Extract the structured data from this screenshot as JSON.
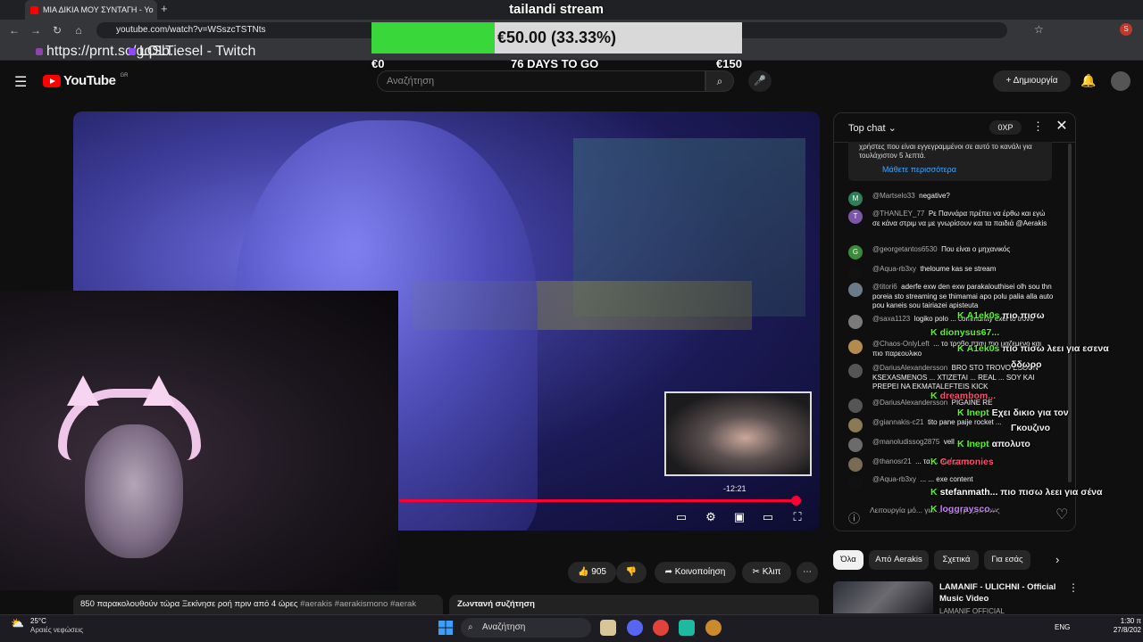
{
  "browser": {
    "tab_title": "ΜΙΑ ΔΙΚΙΑ ΜΟΥ ΣΥΝΤΑΓΗ - Yo",
    "url": "youtube.com/watch?v=WSszcTSTNts",
    "bookmarks": [
      "https://prnt.sc/gqSb...",
      "LOLTiesel - Twitch"
    ]
  },
  "youtube": {
    "logo": "YouTube",
    "region": "GR",
    "search_placeholder": "Αναζήτηση",
    "create_label": "Δημιουργία"
  },
  "donation": {
    "title": "tailandi stream",
    "amount_text": "€50.00 (33.33%)",
    "progress_pct": 33.33,
    "min_label": "€0",
    "days_label": "76 DAYS TO GO",
    "max_label": "€150"
  },
  "player": {
    "time_remaining": "-12:21",
    "progress_pct": 96
  },
  "actions": {
    "likes": "905",
    "share": "Κοινοποίηση",
    "clip": "Κλιπ",
    "more": "⋯"
  },
  "description": {
    "text": "850 παρακολουθούν τώρα  Ξεκίνησε ροή πριν από 4 ώρες",
    "tags": "#aerakis #aerakismono #aerak",
    "live_chat": "Ζωντανή συζήτηση"
  },
  "chat": {
    "title": "Top chat",
    "xp": "0XP",
    "info_text": "χρήστες που είναι εγγεγραμμένοι σε αυτό το κανάλι για τουλάχιστον 5 λεπτά.",
    "info_link": "Μάθετε περισσότερα",
    "messages": [
      {
        "avatar": "M",
        "color": "#2e7d5b",
        "user": "@Martselo33",
        "text": "negative?"
      },
      {
        "avatar": "T",
        "color": "#7b57a8",
        "user": "@THANLEY_77",
        "text": "Ρε Παννάρα πρέπει να έρθω και εγώ σε κάνα στριμ να με γνωρίσουν και τα παιδιά @Aerakis"
      },
      {
        "avatar": "G",
        "color": "#3a8b3a",
        "user": "@georgetantos6530",
        "text": "Που είναι ο μηχανικός"
      },
      {
        "avatar": "",
        "color": "#111111",
        "user": "@Aqua-rb3xy",
        "text": "theloume kas se stream"
      },
      {
        "avatar": "",
        "color": "#6a7a86",
        "user": "@titori6",
        "text": "aderfe exw den exw parakalouthisei olh sou thn poreia sto streaming se thimamai apo polu palia alla auto pou kaneis sou tairiazei apisteuta"
      },
      {
        "avatar": "",
        "color": "#7a7a7a",
        "user": "@saxa1123",
        "text": "logiko polo ... community exei to trovo"
      },
      {
        "avatar": "",
        "color": "#b38b4d",
        "user": "@Chaos-OnlyLeft",
        "text": "... το τροβο πταν πιο μαζεμενο και πιο παρεουλικο"
      },
      {
        "avatar": "",
        "color": "#555555",
        "user": "@DariusAlexandersson",
        "text": "BRO STO TROVO ESOUN KSEXASMENOS ... XTIZETAI ... REAL ... SOY KAI PREPEI NA EKMATALEFTEIS KICK"
      },
      {
        "avatar": "",
        "color": "#555555",
        "user": "@DariusAlexandersson",
        "text": "PIGAINE RE"
      },
      {
        "avatar": "",
        "color": "#8a7a55",
        "user": "@giannakis-c21",
        "text": "tito pane paije rocket ..."
      },
      {
        "avatar": "",
        "color": "#6b6b6b",
        "user": "@manoludissog2875",
        "text": "vell ..."
      },
      {
        "avatar": "",
        "color": "#7a6b55",
        "user": "@thanosr21",
        "text": "... τα ... πράγματα"
      },
      {
        "avatar": "",
        "color": "#111111",
        "user": "@Aqua-rb3xy",
        "text": "... ... exe content"
      }
    ],
    "input_placeholder": "Λειτουργία μό... για ... εγγεγραμμένους"
  },
  "twitch_overlay": [
    {
      "user": "A1ek0s",
      "color": "#53fc18",
      "text": "πιο πισω"
    },
    {
      "user": "dionysus67...",
      "color": "#53fc18",
      "text": ""
    },
    {
      "user": "A1ek0s",
      "color": "#53fc18",
      "text": "πιο πισω λεει για εσενα"
    },
    {
      "user": "",
      "color": "#ffffff",
      "text": "δδωρο"
    },
    {
      "user": "dreambom...",
      "color": "#ff4d6d",
      "text": ""
    },
    {
      "user": "Inept",
      "color": "#53fc18",
      "text": "Εχει δικιο για τον"
    },
    {
      "user": "",
      "color": "#ffffff",
      "text": "Γκουζινο"
    },
    {
      "user": "Inept",
      "color": "#53fc18",
      "text": "απολυτο"
    },
    {
      "user": "Ceramonies",
      "color": "#ff4d6d",
      "text": ""
    },
    {
      "user": "stefanmath...",
      "color": "#ffffff",
      "text": "πιο πισω λεει για σένα"
    },
    {
      "user": "loggraysco...",
      "color": "#c77dff",
      "text": ""
    }
  ],
  "recommendations": {
    "chips": [
      "Όλα",
      "Από Aerakis",
      "Σχετικά",
      "Για εσάς"
    ],
    "video_title": "LAMANIF - ULICHNI - Official Music Video",
    "channel": "LAMANIF OFFICIAL"
  },
  "taskbar": {
    "temp": "25°C",
    "weather": "Αραιές νεφώσεις",
    "search": "Αναζήτηση",
    "lang": "ENG",
    "time": "1:30 π",
    "date": "27/8/202"
  }
}
